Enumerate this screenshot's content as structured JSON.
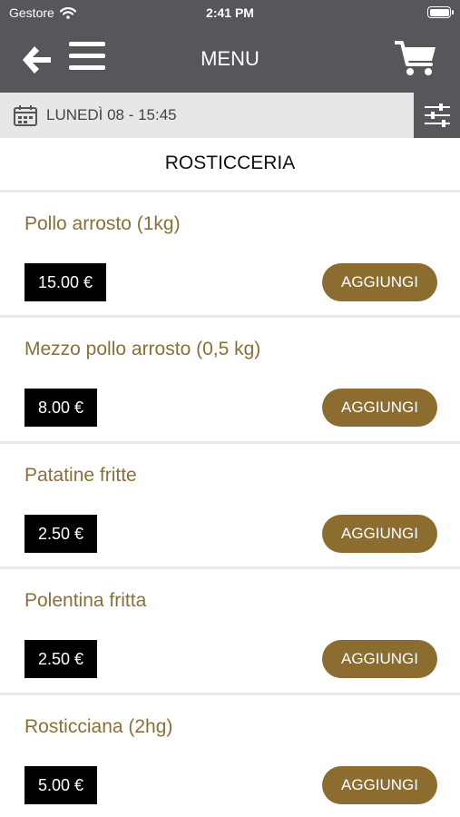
{
  "status_bar": {
    "carrier": "Gestore",
    "time": "2:41 PM"
  },
  "header": {
    "title": "MENU"
  },
  "date_bar": {
    "date": "LUNEDÌ 08 - 15:45"
  },
  "section": {
    "title": "ROSTICCERIA"
  },
  "items": [
    {
      "name": "Pollo arrosto (1kg)",
      "price": "15.00 €",
      "button": "AGGIUNGI"
    },
    {
      "name": "Mezzo pollo arrosto (0,5 kg)",
      "price": "8.00 €",
      "button": "AGGIUNGI"
    },
    {
      "name": "Patatine fritte",
      "price": "2.50 €",
      "button": "AGGIUNGI"
    },
    {
      "name": "Polentina fritta",
      "price": "2.50 €",
      "button": "AGGIUNGI"
    },
    {
      "name": "Rosticciana (2hg)",
      "price": "5.00 €",
      "button": "AGGIUNGI"
    }
  ],
  "icons": {
    "back": "arrow-left-icon",
    "menu": "hamburger-icon",
    "cart": "cart-icon",
    "calendar": "calendar-icon",
    "filter": "sliders-icon",
    "wifi": "wifi-icon",
    "battery": "battery-icon"
  },
  "colors": {
    "nav_background": "#56565b",
    "accent_gold": "#8c6d2f",
    "item_text": "#8a6f39",
    "price_background": "#000000"
  }
}
